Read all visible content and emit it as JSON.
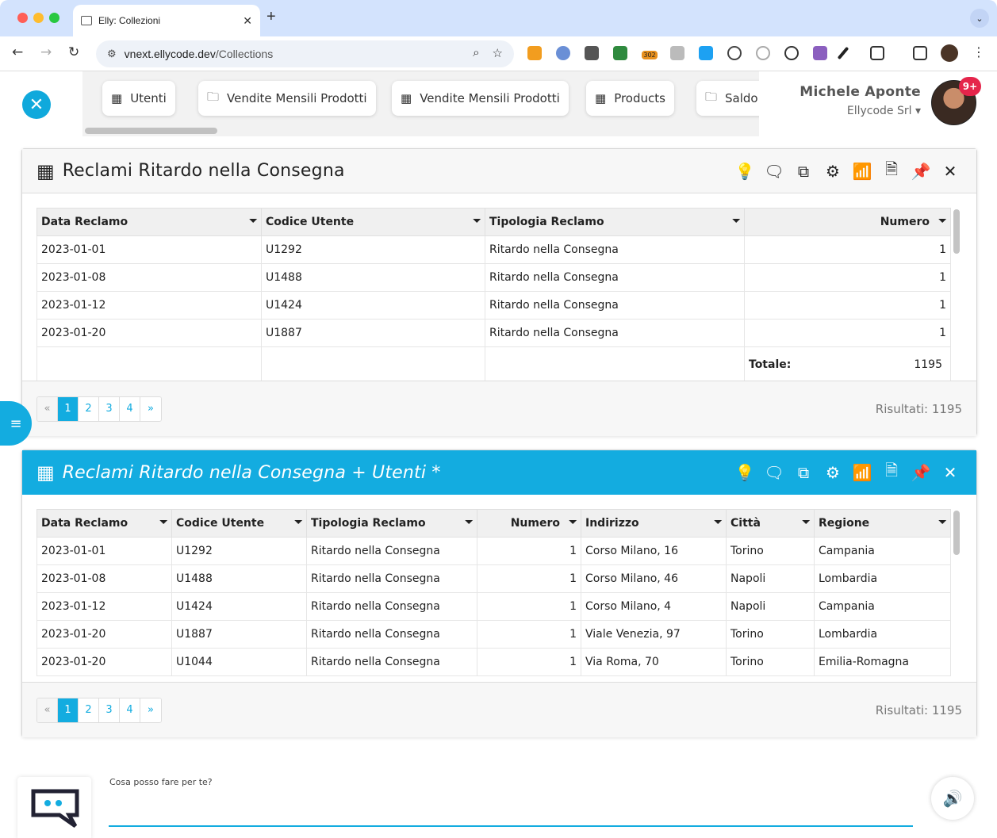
{
  "browser": {
    "tab_title": "Elly: Collezioni",
    "url_host": "vnext.ellycode.dev",
    "url_path": "/Collections",
    "ext_badge": "302"
  },
  "collections": [
    {
      "label": "Utenti",
      "icon": "table-icon"
    },
    {
      "label": "Vendite Mensili Prodotti",
      "icon": "folder-icon"
    },
    {
      "label": "Vendite Mensili Prodotti",
      "icon": "table-icon"
    },
    {
      "label": "Products",
      "icon": "table-icon"
    },
    {
      "label": "Saldo",
      "icon": "folder-icon"
    }
  ],
  "user": {
    "name": "Michele Aponte",
    "company": "Ellycode Srl",
    "notifications": "9+"
  },
  "panel1": {
    "title": "Reclami Ritardo nella Consegna",
    "columns": [
      "Data Reclamo",
      "Codice Utente",
      "Tipologia Reclamo",
      "Numero"
    ],
    "rows": [
      [
        "2023-01-01",
        "U1292",
        "Ritardo nella Consegna",
        "1"
      ],
      [
        "2023-01-08",
        "U1488",
        "Ritardo nella Consegna",
        "1"
      ],
      [
        "2023-01-12",
        "U1424",
        "Ritardo nella Consegna",
        "1"
      ],
      [
        "2023-01-20",
        "U1887",
        "Ritardo nella Consegna",
        "1"
      ]
    ],
    "total_label": "Totale:",
    "total_value": "1195",
    "pages": [
      "«",
      "1",
      "2",
      "3",
      "4",
      "»"
    ],
    "results": "Risultati: 1195"
  },
  "panel2": {
    "title": "Reclami Ritardo nella Consegna + Utenti *",
    "columns": [
      "Data Reclamo",
      "Codice Utente",
      "Tipologia Reclamo",
      "Numero",
      "Indirizzo",
      "Città",
      "Regione"
    ],
    "rows": [
      [
        "2023-01-01",
        "U1292",
        "Ritardo nella Consegna",
        "1",
        "Corso Milano, 16",
        "Torino",
        "Campania"
      ],
      [
        "2023-01-08",
        "U1488",
        "Ritardo nella Consegna",
        "1",
        "Corso Milano, 46",
        "Napoli",
        "Lombardia"
      ],
      [
        "2023-01-12",
        "U1424",
        "Ritardo nella Consegna",
        "1",
        "Corso Milano, 4",
        "Napoli",
        "Campania"
      ],
      [
        "2023-01-20",
        "U1887",
        "Ritardo nella Consegna",
        "1",
        "Viale Venezia, 97",
        "Torino",
        "Lombardia"
      ],
      [
        "2023-01-20",
        "U1044",
        "Ritardo nella Consegna",
        "1",
        "Via Roma, 70",
        "Torino",
        "Emilia-Romagna"
      ]
    ],
    "pages": [
      "«",
      "1",
      "2",
      "3",
      "4",
      "»"
    ],
    "results": "Risultati: 1195"
  },
  "chat": {
    "prompt": "Cosa posso fare per te?"
  },
  "colors": {
    "accent": "#13ace0",
    "badge": "#e5254b"
  }
}
